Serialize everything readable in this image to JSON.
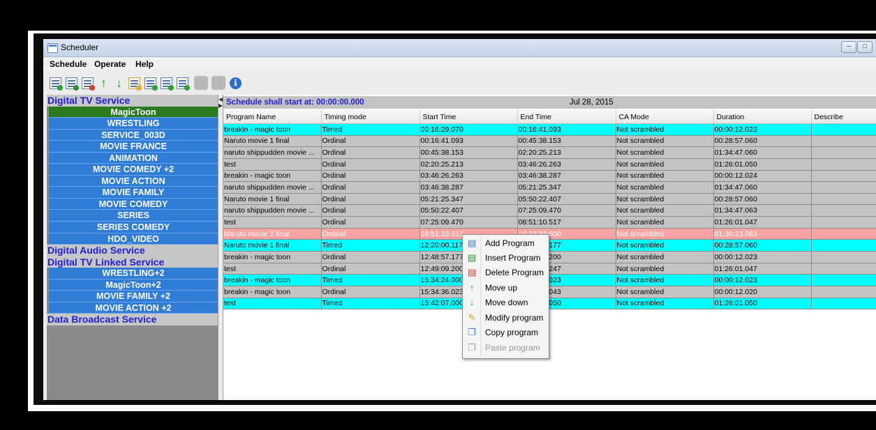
{
  "window": {
    "title": "Scheduler"
  },
  "menu": [
    "Schedule",
    "Operate",
    "Help"
  ],
  "toolbar": {
    "icons": [
      "add-program-icon",
      "insert-program-icon",
      "delete-program-icon",
      "move-up-icon",
      "move-down-icon",
      "modify-program-icon",
      "play-icon",
      "export-icon",
      "import-icon",
      "copy-icon",
      "paste-icon",
      "info-icon"
    ]
  },
  "sidebar": {
    "sections": [
      {
        "label": "Digital TV Service",
        "items": [
          "MagicToon",
          "WRESTLING",
          "SERVICE_003D",
          "MOVIE FRANCE",
          "ANIMATION",
          "MOVIE COMEDY +2",
          "MOVIE ACTION",
          "MOVIE FAMILY",
          "MOVIE COMEDY",
          "SERIES",
          "SERIES COMEDY",
          "HDO_VIDEO"
        ]
      },
      {
        "label": "Digital Audio Service",
        "items": []
      },
      {
        "label": "Digital TV Linked Service",
        "items": [
          "WRESTLING+2",
          "MagicToon+2",
          "MOVIE FAMILY +2",
          "MOVIE ACTION +2"
        ]
      },
      {
        "label": "Data Broadcast Service",
        "items": []
      }
    ],
    "selected": "MagicToon"
  },
  "schedule": {
    "start_label": "Schedule shall start at:  00:00:00.000",
    "date": "Jul 28, 2015",
    "columns": [
      "Program Name",
      "Timing mode",
      "Start Time",
      "End Time",
      "CA Mode",
      "Duration",
      "Describe"
    ],
    "rows": [
      {
        "type": "timed",
        "cells": [
          "breakin - magic toon",
          "Timed",
          "00:16:29.070",
          "00:16:41.093",
          "Not scrambled",
          "00:00:12.023",
          ""
        ]
      },
      {
        "type": "ordinal",
        "cells": [
          "Naruto movie 1 final",
          "Ordinal",
          "00:16:41.093",
          "00:45:38.153",
          "Not scrambled",
          "00:28:57.060",
          ""
        ]
      },
      {
        "type": "ordinal",
        "cells": [
          "naruto shippudden movie ...",
          "Ordinal",
          "00:45:38.153",
          "02:20:25.213",
          "Not scrambled",
          "01:34:47.060",
          ""
        ]
      },
      {
        "type": "ordinal",
        "cells": [
          "test",
          "Ordinal",
          "02:20:25.213",
          "03:46:26.263",
          "Not scrambled",
          "01:26:01.050",
          ""
        ]
      },
      {
        "type": "ordinal",
        "cells": [
          "breakin - magic toon",
          "Ordinal",
          "03:46:26.263",
          "03:46:38.287",
          "Not scrambled",
          "00:00:12.024",
          ""
        ]
      },
      {
        "type": "ordinal",
        "cells": [
          "naruto shippudden movie ...",
          "Ordinal",
          "03:46:38.287",
          "05:21:25.347",
          "Not scrambled",
          "01:34:47.060",
          ""
        ]
      },
      {
        "type": "ordinal",
        "cells": [
          "Naruto movie 1 final",
          "Ordinal",
          "05:21:25.347",
          "05:50:22.407",
          "Not scrambled",
          "00:28:57.060",
          ""
        ]
      },
      {
        "type": "ordinal",
        "cells": [
          "naruto shippudden movie ...",
          "Ordinal",
          "05:50:22.407",
          "07:25:09.470",
          "Not scrambled",
          "01:34:47.063",
          ""
        ]
      },
      {
        "type": "ordinal",
        "cells": [
          "test",
          "Ordinal",
          "07:25:09.470",
          "08:51:10.517",
          "Not scrambled",
          "01:26:01.047",
          ""
        ]
      },
      {
        "type": "selected",
        "cells": [
          "Naruto movie 2 final",
          "Ordinal",
          "08:51:10.517",
          "10:27:33.600",
          "Not scrambled",
          "01:36:23.083",
          ""
        ]
      },
      {
        "type": "timed",
        "cells": [
          "Naruto movie 1 final",
          "Timed",
          "12:20:00.117",
          "12:48:57.177",
          "Not scrambled",
          "00:28:57.060",
          ""
        ]
      },
      {
        "type": "ordinal",
        "cells": [
          "breakin - magic toon",
          "Ordinal",
          "12:48:57.177",
          "12:49:09.200",
          "Not scrambled",
          "00:00:12.023",
          ""
        ]
      },
      {
        "type": "ordinal",
        "cells": [
          "test",
          "Ordinal",
          "12:49:09.200",
          "14:15:10.247",
          "Not scrambled",
          "01:26:01.047",
          ""
        ]
      },
      {
        "type": "timed",
        "cells": [
          "breakin - magic toon",
          "Timed",
          "15:34:24.000",
          "15:34:36.023",
          "Not scrambled",
          "00:00:12.023",
          ""
        ]
      },
      {
        "type": "ordinal",
        "cells": [
          "breakin - magic toon",
          "Ordinal",
          "15:34:36.023",
          "15:34:48.043",
          "Not scrambled",
          "00:00:12.020",
          ""
        ]
      },
      {
        "type": "timed",
        "cells": [
          "test",
          "Timed",
          "15:42:07.000",
          "17:08:08.050",
          "Not scrambled",
          "01:26:01.050",
          ""
        ]
      }
    ]
  },
  "context_menu": {
    "items": [
      {
        "label": "Add Program",
        "icon": "add-program-icon",
        "enabled": true
      },
      {
        "label": "Insert Program",
        "icon": "insert-program-icon",
        "enabled": true
      },
      {
        "label": "Delete Program",
        "icon": "delete-program-icon",
        "enabled": true
      },
      {
        "label": "Move up",
        "icon": "move-up-icon",
        "enabled": true
      },
      {
        "label": "Move down",
        "icon": "move-down-icon",
        "enabled": true
      },
      {
        "label": "Modify program",
        "icon": "modify-program-icon",
        "enabled": true
      },
      {
        "label": "Copy program",
        "icon": "copy-icon",
        "enabled": true
      },
      {
        "label": "Paste program",
        "icon": "paste-icon",
        "enabled": false
      }
    ]
  },
  "colors": {
    "timed": "#00ffff",
    "ordinal": "#c3c3c3",
    "selected": "#f9a3a3",
    "sidebar_item": "#2f7dd6",
    "sidebar_selected": "#2b7a1f",
    "section_text": "#1f1fd6"
  }
}
